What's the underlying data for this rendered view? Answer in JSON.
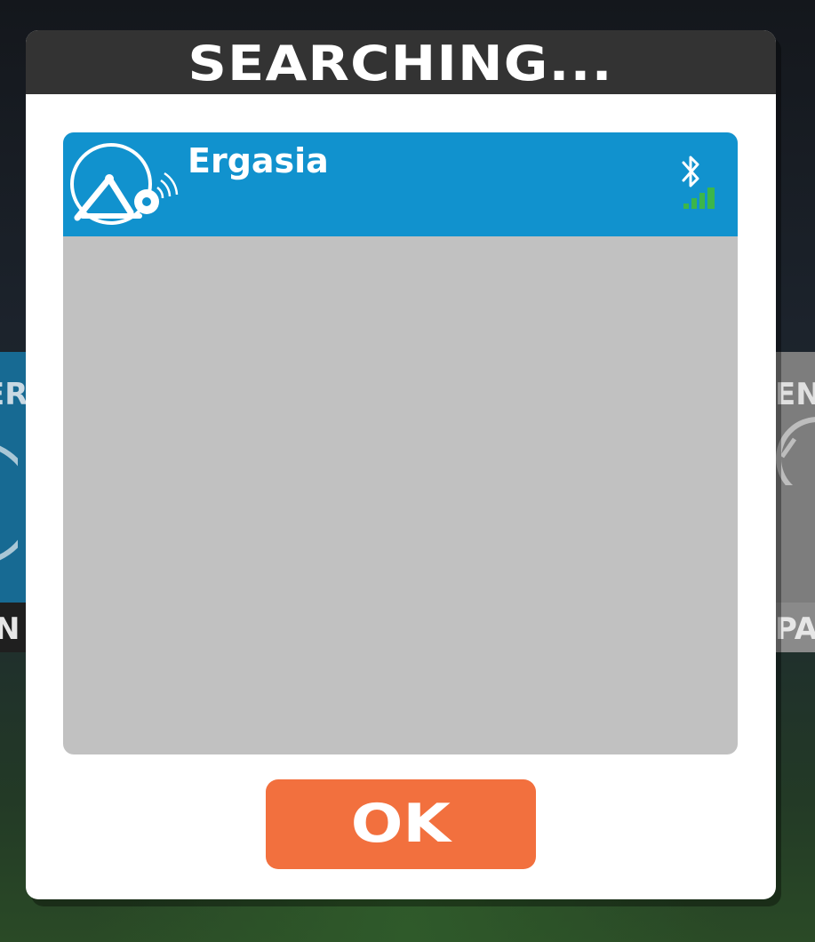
{
  "dialog": {
    "title": "SEARCHING..."
  },
  "devices": [
    {
      "name": "Ergasia",
      "icon": "power-trainer-icon",
      "connection_icon": "bluetooth-icon",
      "signal_icon": "signal-strength-icon",
      "signal_bars_filled": 4
    }
  ],
  "buttons": {
    "ok_label": "OK"
  },
  "colors": {
    "header_bg": "#333333",
    "device_row_bg": "#1192ce",
    "list_bg": "#c1c1c1",
    "ok_button_bg": "#f2703e",
    "signal_green": "#3cb64a"
  },
  "background_cards": {
    "left_top_text": "ER",
    "left_bottom_text": "N",
    "right_top_text": "EN",
    "right_bottom_text": "PA"
  }
}
